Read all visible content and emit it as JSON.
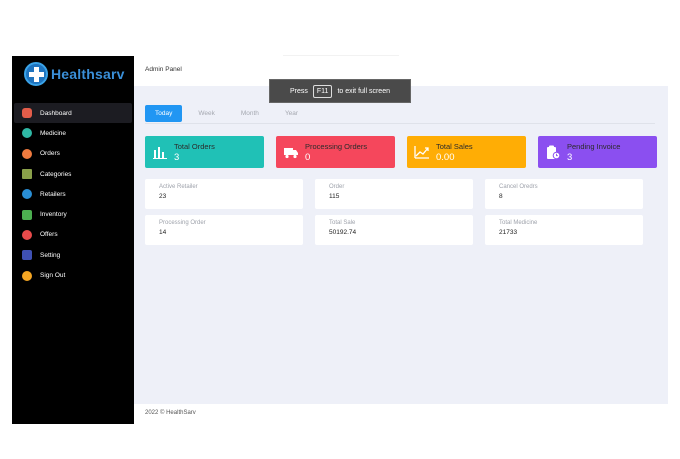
{
  "brand": {
    "name": "Healthsarv"
  },
  "sidebar": {
    "items": [
      {
        "label": "Dashboard",
        "icon": "dashboard-icon"
      },
      {
        "label": "Medicine",
        "icon": "medicine-icon"
      },
      {
        "label": "Orders",
        "icon": "orders-icon"
      },
      {
        "label": "Categories",
        "icon": "categories-icon"
      },
      {
        "label": "Retailers",
        "icon": "retailers-icon"
      },
      {
        "label": "Inventory",
        "icon": "inventory-icon"
      },
      {
        "label": "Offers",
        "icon": "offers-icon"
      },
      {
        "label": "Setting",
        "icon": "setting-icon"
      },
      {
        "label": "Sign Out",
        "icon": "sign-out-icon"
      }
    ],
    "active": "Dashboard"
  },
  "header": {
    "title": "Admin Panel"
  },
  "tabs": [
    "Today",
    "Week",
    "Month",
    "Year"
  ],
  "active_tab": "Today",
  "stats": [
    {
      "title": "Total Orders",
      "value": "3",
      "color": "#20c1b6",
      "icon": "bar-chart-icon"
    },
    {
      "title": "Processing Orders",
      "value": "0",
      "color": "#f5475c",
      "icon": "delivery-truck-icon"
    },
    {
      "title": "Total Sales",
      "value": "0.00",
      "color": "#ffad05",
      "icon": "trend-up-icon"
    },
    {
      "title": "Pending Invoice",
      "value": "3",
      "color": "#8b4ff0",
      "icon": "clipboard-clock-icon"
    }
  ],
  "cards": [
    {
      "label": "Active Retailer",
      "value": "23"
    },
    {
      "label": "Order",
      "value": "115"
    },
    {
      "label": "Cancel Oredrs",
      "value": "8"
    },
    {
      "label": "Processing Order",
      "value": "14"
    },
    {
      "label": "Total Sale",
      "value": "50192.74"
    },
    {
      "label": "Total Medicine",
      "value": "21733"
    }
  ],
  "footer": {
    "text": "2022  © HealthSarv"
  },
  "fullscreen_toast": {
    "pre": "Press",
    "key": "F11",
    "post": "to exit full screen"
  }
}
